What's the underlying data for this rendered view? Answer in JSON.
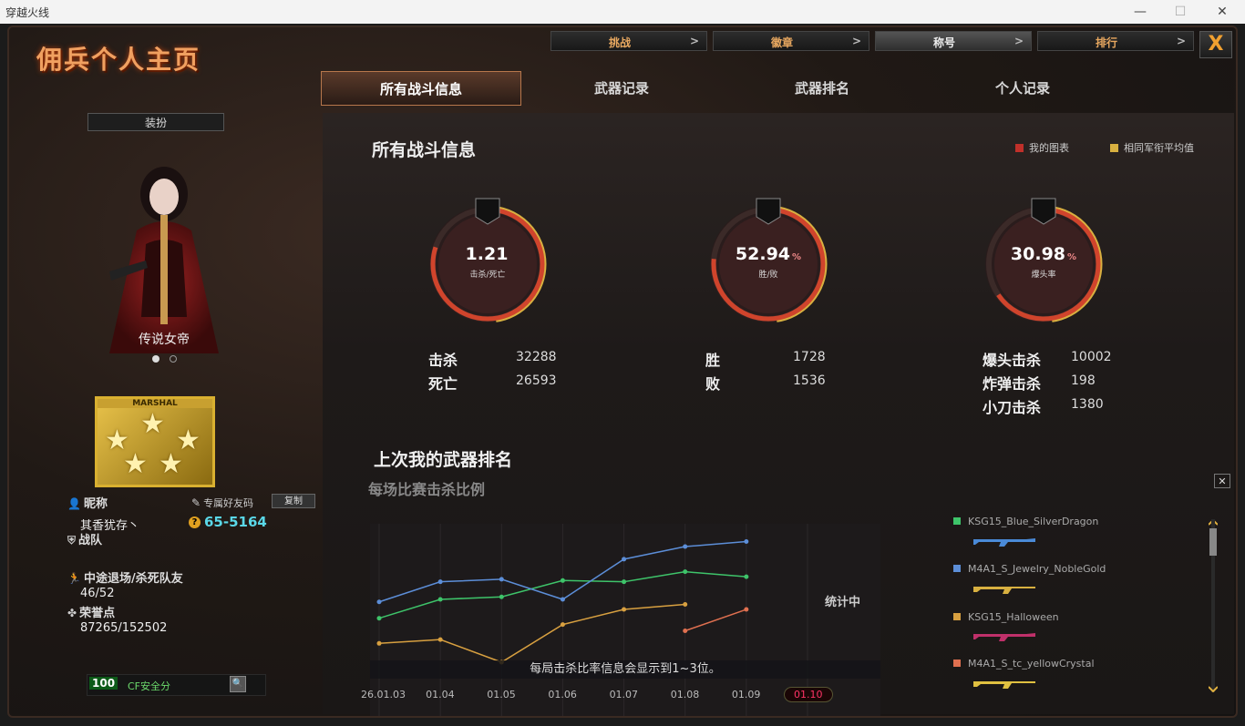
{
  "window": {
    "title": "穿越火线",
    "minimize": "—",
    "maximize": "☐",
    "close": "✕"
  },
  "header": {
    "page_title": "佣兵个人主页",
    "top_tabs": [
      {
        "label": "挑战",
        "arrow": ">"
      },
      {
        "label": "徽章",
        "arrow": ">"
      },
      {
        "label": "称号",
        "arrow": ">",
        "active": true
      },
      {
        "label": "排行",
        "arrow": ">"
      }
    ],
    "close_label": "X",
    "sub_tabs": [
      {
        "label": "所有战斗信息",
        "active": true
      },
      {
        "label": "武器记录"
      },
      {
        "label": "武器排名"
      },
      {
        "label": "个人记录"
      }
    ]
  },
  "profile": {
    "outfit_button": "装扮",
    "character_name": "传说女帝",
    "rank_label": "MARSHAL",
    "nickname_label": "昵称",
    "nickname": "其香犹存丶",
    "friend_code_label": "专属好友码",
    "copy_button": "复制",
    "friend_code": "65-5164",
    "team_label": "战队",
    "quit_label": "中途退场/杀死队友",
    "quit_value": "46/52",
    "honor_label": "荣誉点",
    "honor_value": "87265/152502",
    "safety_score": "100",
    "safety_label": "CF安全分"
  },
  "stats": {
    "section_title": "所有战斗信息",
    "legend_mine": "我的图表",
    "legend_avg": "相同军衔平均值",
    "gauges": [
      {
        "value": "1.21",
        "unit": "",
        "label": "击杀/死亡",
        "fill": 0.6
      },
      {
        "value": "52.94",
        "unit": "%",
        "label": "胜/败",
        "fill": 0.53
      },
      {
        "value": "30.98",
        "unit": "%",
        "label": "爆头率",
        "fill": 0.31
      }
    ],
    "kills_label": "击杀",
    "kills": "32288",
    "deaths_label": "死亡",
    "deaths": "26593",
    "wins_label": "胜",
    "wins": "1728",
    "losses_label": "败",
    "losses": "1536",
    "headshot_label": "爆头击杀",
    "headshot": "10002",
    "bomb_label": "炸弹击杀",
    "bomb": "198",
    "knife_label": "小刀击杀",
    "knife": "1380"
  },
  "weapon_section": {
    "title": "上次我的武器排名",
    "chart_subtitle": "每场比赛击杀比例",
    "chart_note": "每局击杀比率信息会显示到1~3位。",
    "counting": "统计中",
    "weapons": [
      {
        "name": "KSG15_Blue_SilverDragon",
        "color": "#3ec46a"
      },
      {
        "name": "M4A1_S_Jewelry_NobleGold",
        "color": "#5c8ed8"
      },
      {
        "name": "KSG15_Halloween",
        "color": "#d8a040"
      },
      {
        "name": "M4A1_S_tc_yellowCrystal",
        "color": "#e07050"
      }
    ]
  },
  "chart_data": {
    "type": "line",
    "x": [
      "26.01.03",
      "01.04",
      "01.05",
      "01.06",
      "01.07",
      "01.08",
      "01.09",
      "01.10"
    ],
    "series": [
      {
        "name": "KSG15_Blue_SilverDragon",
        "color": "#3ec46a",
        "values": [
          0.35,
          0.5,
          0.52,
          0.65,
          0.64,
          0.72,
          0.68,
          null
        ]
      },
      {
        "name": "M4A1_S_Jewelry_NobleGold",
        "color": "#5c8ed8",
        "values": [
          0.48,
          0.64,
          0.66,
          0.5,
          0.82,
          0.92,
          0.96,
          null
        ]
      },
      {
        "name": "KSG15_Halloween",
        "color": "#d8a040",
        "values": [
          0.15,
          0.18,
          0.0,
          0.3,
          0.42,
          0.46,
          null,
          null
        ]
      },
      {
        "name": "M4A1_S_tc_yellowCrystal",
        "color": "#e07050",
        "values": [
          null,
          null,
          null,
          null,
          null,
          0.25,
          0.42,
          null
        ]
      }
    ],
    "active_x": "01.10"
  }
}
